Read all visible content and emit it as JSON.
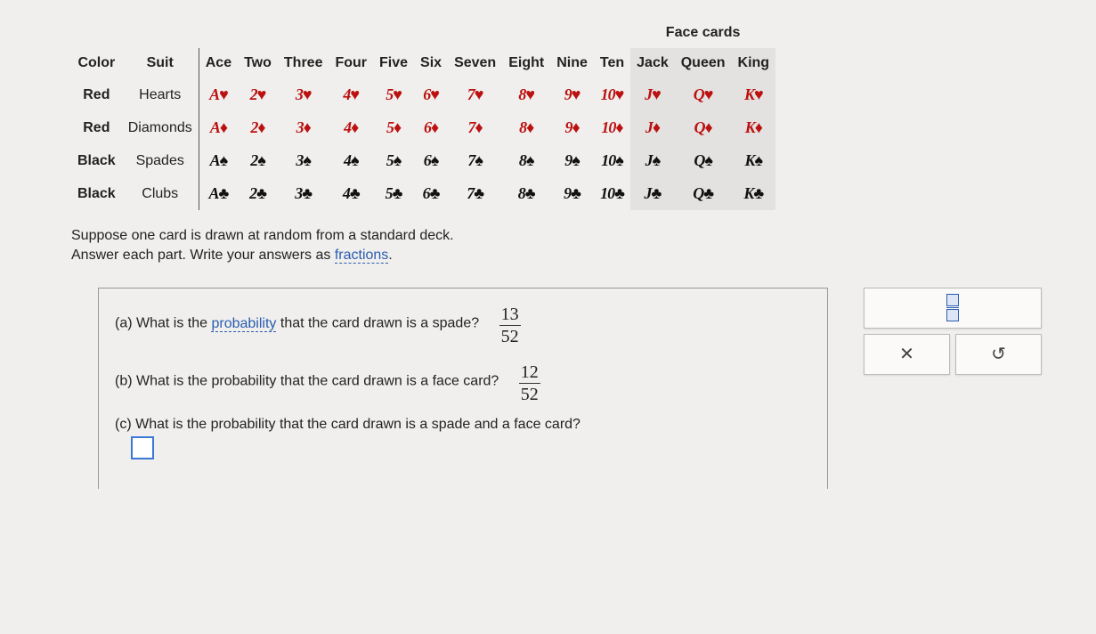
{
  "deck": {
    "face_title": "Face cards",
    "headers": [
      "Color",
      "Suit",
      "Ace",
      "Two",
      "Three",
      "Four",
      "Five",
      "Six",
      "Seven",
      "Eight",
      "Nine",
      "Ten",
      "Jack",
      "Queen",
      "King"
    ],
    "rows": [
      {
        "color": "Red",
        "suit": "Hearts",
        "sym": "♥",
        "cls": "red",
        "cards": [
          "A",
          "2",
          "3",
          "4",
          "5",
          "6",
          "7",
          "8",
          "9",
          "10",
          "J",
          "Q",
          "K"
        ]
      },
      {
        "color": "Red",
        "suit": "Diamonds",
        "sym": "♦",
        "cls": "red",
        "cards": [
          "A",
          "2",
          "3",
          "4",
          "5",
          "6",
          "7",
          "8",
          "9",
          "10",
          "J",
          "Q",
          "K"
        ]
      },
      {
        "color": "Black",
        "suit": "Spades",
        "sym": "♠",
        "cls": "black",
        "cards": [
          "A",
          "2",
          "3",
          "4",
          "5",
          "6",
          "7",
          "8",
          "9",
          "10",
          "J",
          "Q",
          "K"
        ]
      },
      {
        "color": "Black",
        "suit": "Clubs",
        "sym": "♣",
        "cls": "black",
        "cards": [
          "A",
          "2",
          "3",
          "4",
          "5",
          "6",
          "7",
          "8",
          "9",
          "10",
          "J",
          "Q",
          "K"
        ]
      }
    ]
  },
  "prompt": {
    "line1": "Suppose one card is drawn at random from a standard deck.",
    "line2_a": "Answer each part. Write your answers as ",
    "line2_link": "fractions",
    "line2_b": "."
  },
  "questions": {
    "a": {
      "label_a": "(a) What is the ",
      "link": "probability",
      "label_b": " that the card drawn is a spade?",
      "num": "13",
      "den": "52"
    },
    "b": {
      "label": "(b) What is the probability that the card drawn is a face card?",
      "num": "12",
      "den": "52"
    },
    "c": {
      "label": "(c) What is the probability that the card drawn is a spade and a face card?"
    }
  }
}
